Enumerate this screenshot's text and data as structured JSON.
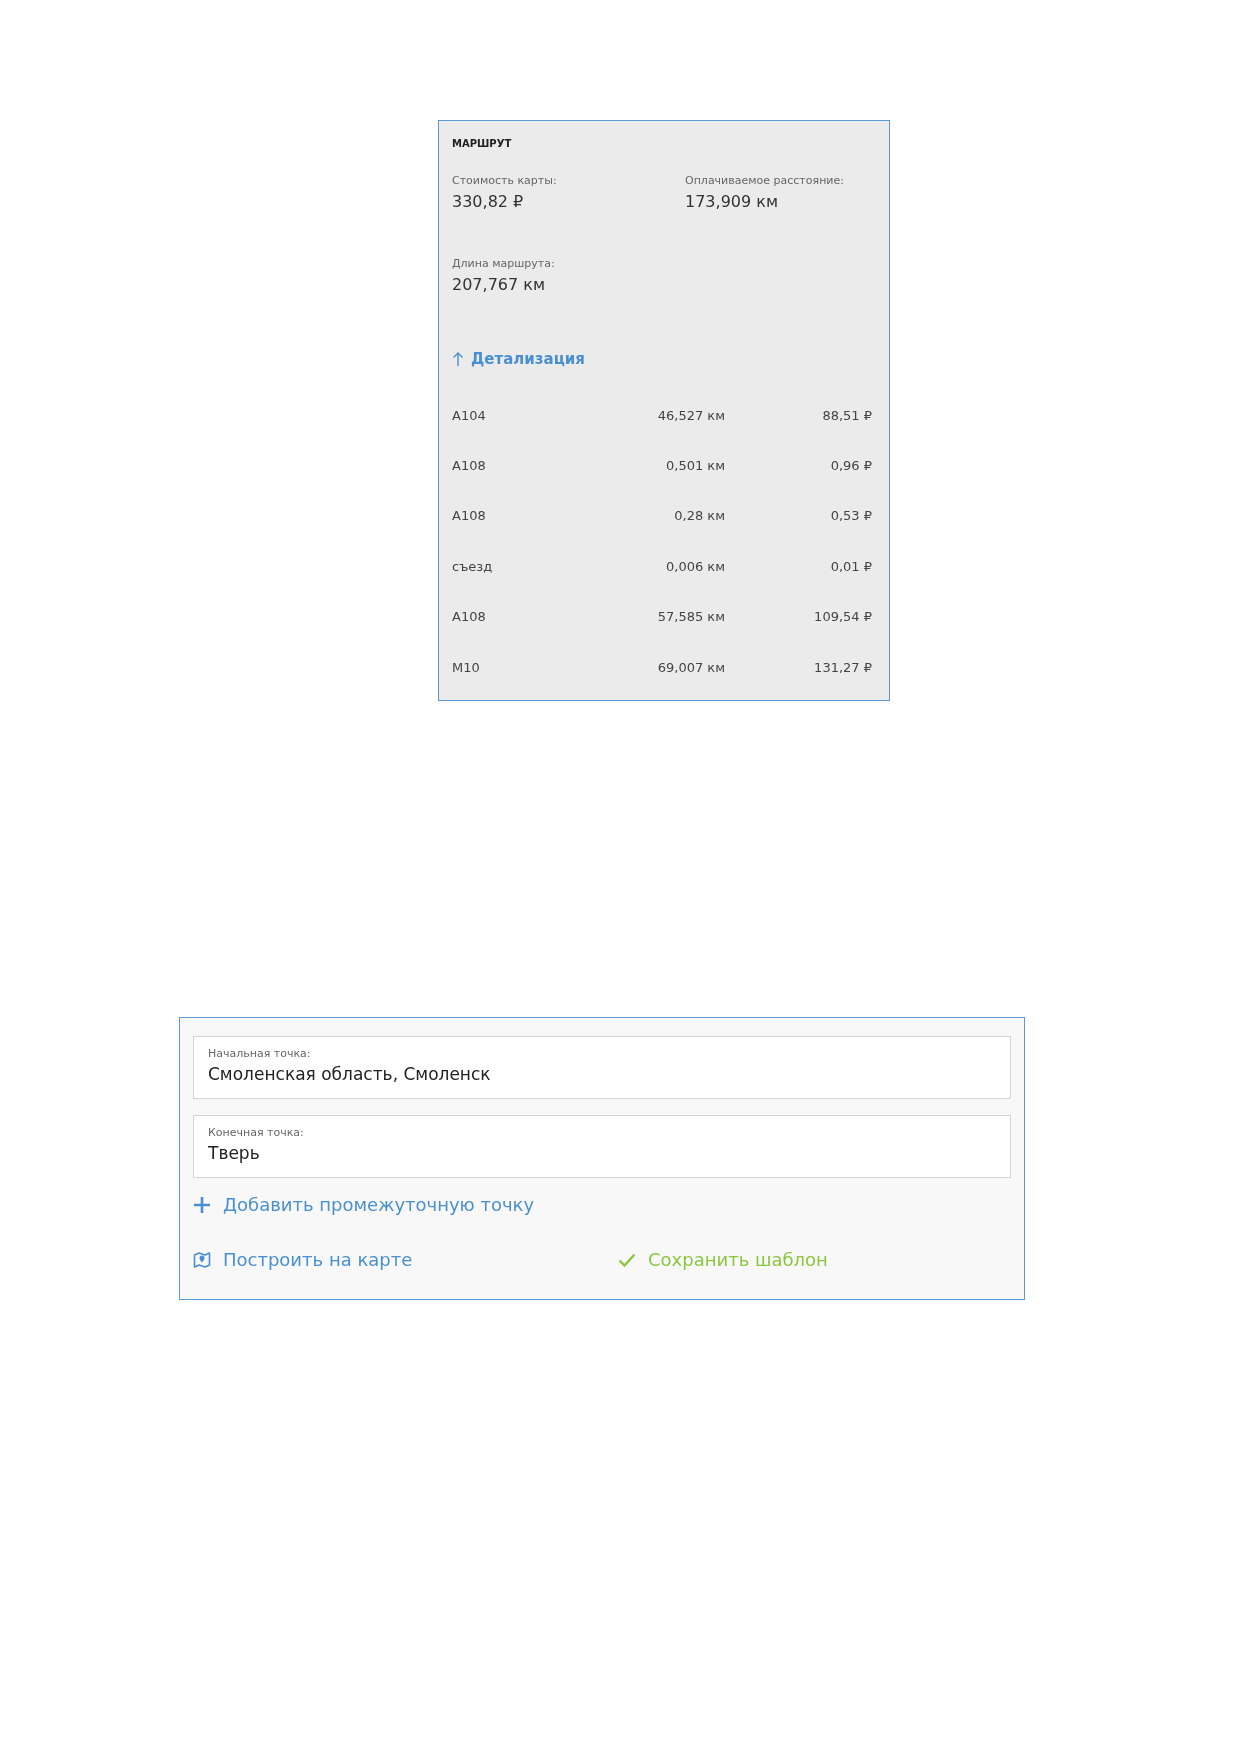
{
  "route": {
    "title": "МАРШРУТ",
    "stats": [
      {
        "label": "Стоимость карты:",
        "value": "330,82 ₽"
      },
      {
        "label": "Оплачиваемое расстояние:",
        "value": "173,909 км"
      },
      {
        "label": "Длина маршрута:",
        "value": "207,767 км"
      }
    ],
    "details": {
      "label": "Детализация",
      "expanded": true
    },
    "segments": [
      {
        "road": "А104",
        "distance": "46,527 км",
        "cost": "88,51 ₽"
      },
      {
        "road": "А108",
        "distance": "0,501 км",
        "cost": "0,96 ₽"
      },
      {
        "road": "А108",
        "distance": "0,28 км",
        "cost": "0,53 ₽"
      },
      {
        "road": "съезд",
        "distance": "0,006 км",
        "cost": "0,01 ₽"
      },
      {
        "road": "А108",
        "distance": "57,585 км",
        "cost": "109,54 ₽"
      },
      {
        "road": "М10",
        "distance": "69,007 км",
        "cost": "131,27 ₽"
      }
    ]
  },
  "route_form": {
    "fields": [
      {
        "label": "Начальная точка:",
        "value": "Смоленская область, Смоленск"
      },
      {
        "label": "Конечная точка:",
        "value": "Тверь"
      }
    ],
    "add_point": "Добавить промежуточную точку",
    "actions": [
      {
        "kind": "map",
        "label": "Построить на карте"
      },
      {
        "kind": "save",
        "label": "Сохранить шаблон"
      }
    ]
  }
}
